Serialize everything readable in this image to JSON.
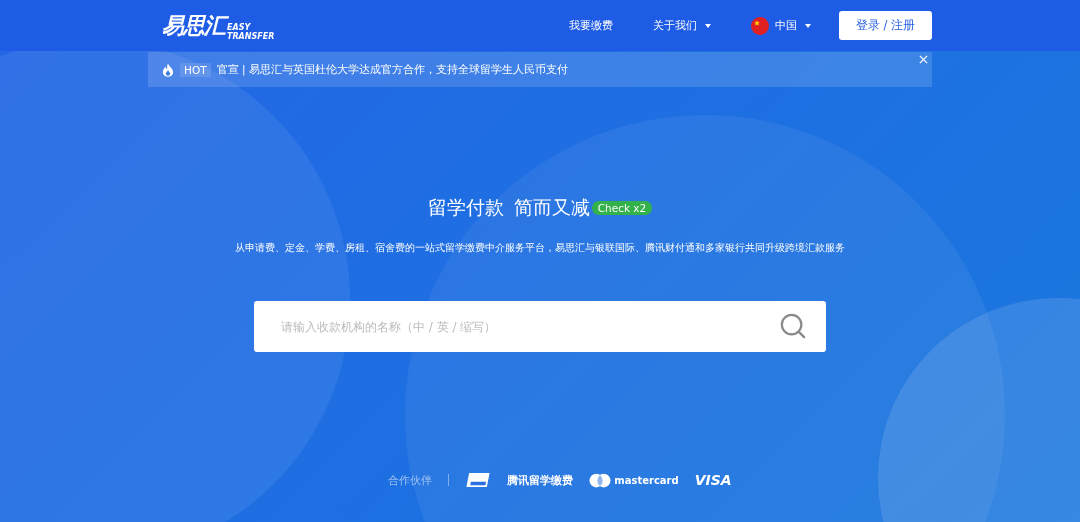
{
  "header": {
    "logo": {
      "name": "易思汇",
      "tagline_1": "EASY",
      "tagline_2": "TRANSFER"
    },
    "nav": [
      {
        "label": "我要缴费",
        "dropdown": false,
        "flag": false
      },
      {
        "label": "关于我们",
        "dropdown": true,
        "flag": false
      },
      {
        "label": "中国",
        "dropdown": true,
        "flag": true
      }
    ],
    "login_button": "登录 / 注册"
  },
  "notice": {
    "badge": "HOT",
    "text": "官宣 | 易思汇与英国杜伦大学达成官方合作，支持全球留学生人民币支付"
  },
  "hero": {
    "title_1": "留学付款",
    "title_2": "简而又减",
    "tag": "Check x2",
    "subtitle": "从申请费、定金、学费、房租、宿舍费的一站式留学缴费中介服务平台，易思汇与银联国际、腾讯财付通和多家银行共同升级跨境汇款服务"
  },
  "search": {
    "placeholder": "请输入收款机构的名称（中 / 英 / 缩写）"
  },
  "partners": {
    "label": "合作伙伴",
    "logos": [
      {
        "kind": "unionpay"
      },
      {
        "kind": "text",
        "text": "腾讯留学缴费"
      },
      {
        "kind": "mastercard",
        "text": "mastercard"
      },
      {
        "kind": "visa",
        "text": "VISA"
      }
    ]
  }
}
